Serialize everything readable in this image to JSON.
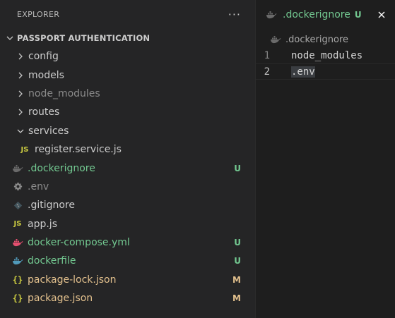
{
  "explorer": {
    "title": "EXPLORER",
    "more_label": "···",
    "project": "PASSPORT AUTHENTICATION",
    "items": [
      {
        "label": "config",
        "type": "folder",
        "expanded": false,
        "status": ""
      },
      {
        "label": "models",
        "type": "folder",
        "expanded": false,
        "status": ""
      },
      {
        "label": "node_modules",
        "type": "folder",
        "expanded": false,
        "status": ""
      },
      {
        "label": "routes",
        "type": "folder",
        "expanded": false,
        "status": ""
      },
      {
        "label": "services",
        "type": "folder",
        "expanded": true,
        "status": ""
      },
      {
        "label": "register.service.js",
        "type": "file",
        "icon": "js-icon",
        "icon_text": "JS",
        "status": ""
      },
      {
        "label": ".dockerignore",
        "type": "file",
        "icon": "docker-icon",
        "status": "U"
      },
      {
        "label": ".env",
        "type": "file",
        "icon": "gear-icon",
        "status": ""
      },
      {
        "label": ".gitignore",
        "type": "file",
        "icon": "git-icon",
        "status": ""
      },
      {
        "label": "app.js",
        "type": "file",
        "icon": "js-icon",
        "icon_text": "JS",
        "status": ""
      },
      {
        "label": "docker-compose.yml",
        "type": "file",
        "icon": "docker-icon",
        "status": "U"
      },
      {
        "label": "dockerfile",
        "type": "file",
        "icon": "docker-icon",
        "status": "U"
      },
      {
        "label": "package-lock.json",
        "type": "file",
        "icon": "json-icon",
        "icon_text": "{}",
        "status": "M"
      },
      {
        "label": "package.json",
        "type": "file",
        "icon": "json-icon",
        "icon_text": "{}",
        "status": "M"
      }
    ]
  },
  "editor": {
    "tab": {
      "label": ".dockerignore",
      "badge": "U"
    },
    "breadcrumb": ".dockerignore",
    "lines": [
      {
        "number": "1",
        "text": "node_modules"
      },
      {
        "number": "2",
        "text": ".env"
      }
    ]
  },
  "colors": {
    "untracked": "#73c991",
    "modified": "#e2c08d",
    "ignored": "#8b8b8b",
    "docker_blue": "#519aba",
    "docker_pink": "#e44f6f",
    "js_yellow": "#cbcb41"
  }
}
